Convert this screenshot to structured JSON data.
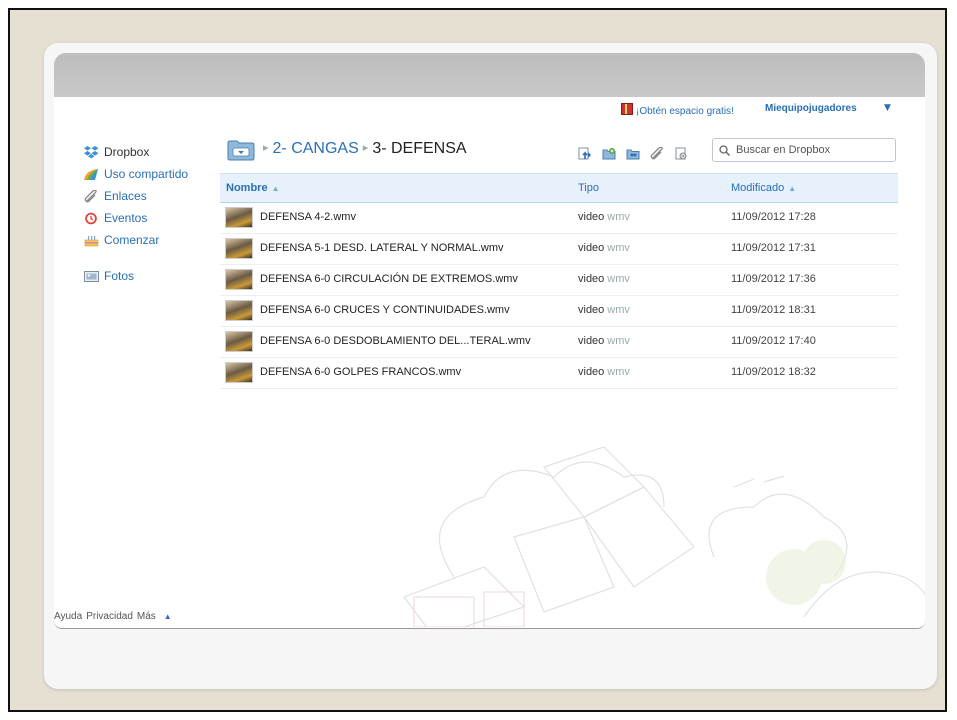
{
  "topbar": {
    "gift_link": "¡Obtén espacio gratis!",
    "account": "Miequipojugadores",
    "account_caret": "▼"
  },
  "sidebar": {
    "items": [
      {
        "label": "Dropbox",
        "icon": "dropbox-logo-icon"
      },
      {
        "label": "Uso compartido",
        "icon": "sharing-icon"
      },
      {
        "label": "Enlaces",
        "icon": "paperclip-icon"
      },
      {
        "label": "Eventos",
        "icon": "events-icon"
      },
      {
        "label": "Comenzar",
        "icon": "cake-icon"
      },
      {
        "label": "Fotos",
        "icon": "photos-icon"
      }
    ]
  },
  "breadcrumb": {
    "parent": "2- CANGAS",
    "current": "3- DEFENSA",
    "separator": "▸"
  },
  "search": {
    "placeholder": "Buscar en Dropbox"
  },
  "table": {
    "headers": {
      "name": "Nombre",
      "type": "Tipo",
      "modified": "Modificado",
      "sort_arrow": "▲"
    },
    "rows": [
      {
        "name": "DEFENSA 4-2.wmv",
        "type": "video",
        "ext": "wmv",
        "modified": "11/09/2012 17:28"
      },
      {
        "name": "DEFENSA 5-1 DESD. LATERAL Y NORMAL.wmv",
        "type": "video",
        "ext": "wmv",
        "modified": "11/09/2012 17:31"
      },
      {
        "name": "DEFENSA 6-0 CIRCULACIÓN DE EXTREMOS.wmv",
        "type": "video",
        "ext": "wmv",
        "modified": "11/09/2012 17:36"
      },
      {
        "name": "DEFENSA 6-0 CRUCES Y CONTINUIDADES.wmv",
        "type": "video",
        "ext": "wmv",
        "modified": "11/09/2012 18:31"
      },
      {
        "name": "DEFENSA 6-0 DESDOBLAMIENTO DEL...TERAL.wmv",
        "type": "video",
        "ext": "wmv",
        "modified": "11/09/2012 17:40"
      },
      {
        "name": "DEFENSA 6-0 GOLPES FRANCOS.wmv",
        "type": "video",
        "ext": "wmv",
        "modified": "11/09/2012 18:32"
      }
    ]
  },
  "footer": {
    "help": "Ayuda",
    "privacy": "Privacidad",
    "more": "Más",
    "arrow": "▲"
  },
  "colors": {
    "link": "#2a6fb5",
    "header_bg": "#e7f1fb",
    "frame_bg": "#e6e0d3"
  }
}
